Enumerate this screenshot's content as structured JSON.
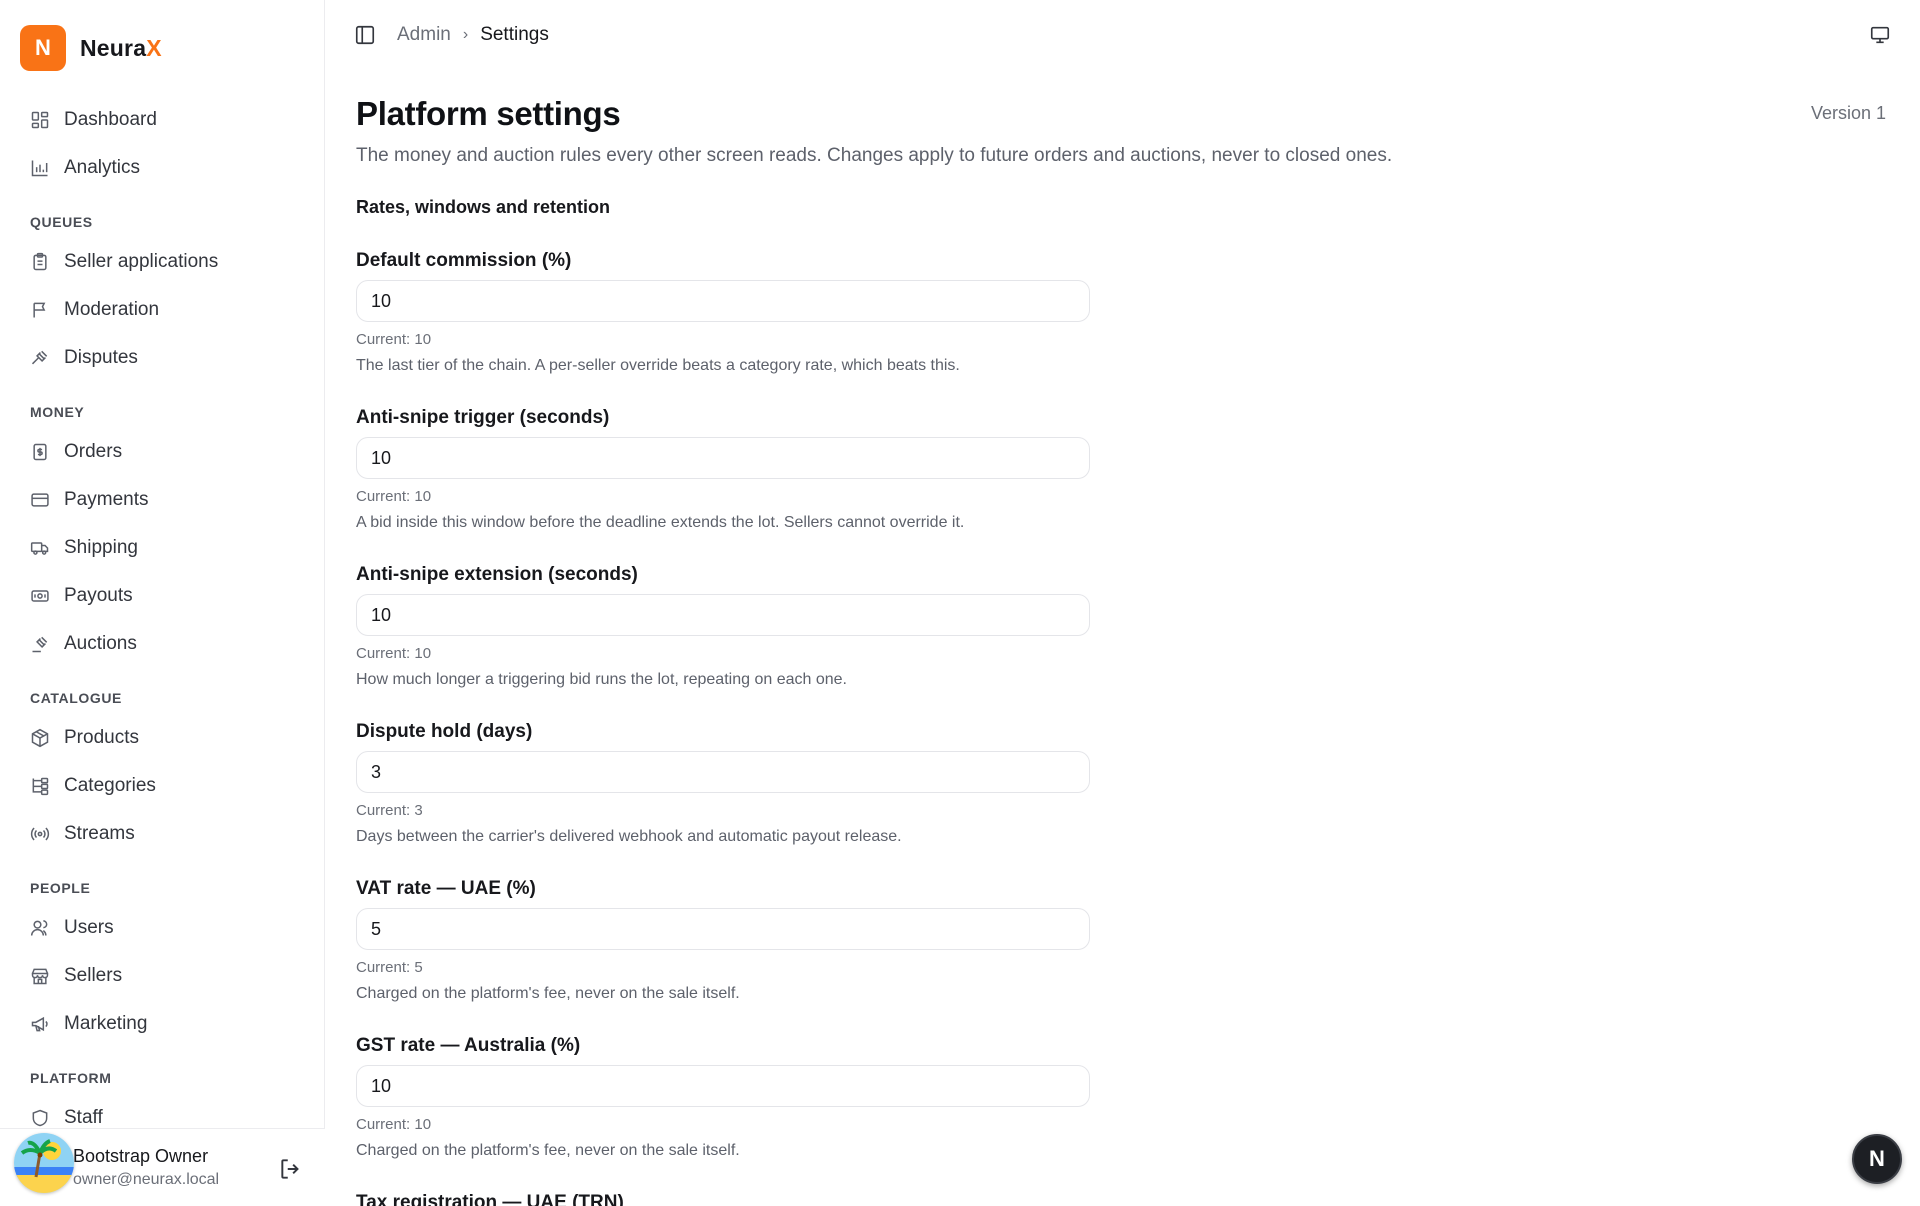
{
  "brand": {
    "logo_letter": "N",
    "name_main": "Neura",
    "name_accent": "X",
    "accent_color": "#f97316"
  },
  "nav": {
    "top": [
      {
        "label": "Dashboard",
        "icon": "dashboard-icon"
      },
      {
        "label": "Analytics",
        "icon": "bar-chart-icon"
      }
    ],
    "queues": {
      "title": "QUEUES",
      "items": [
        {
          "label": "Seller applications",
          "icon": "clipboard-icon"
        },
        {
          "label": "Moderation",
          "icon": "flag-icon"
        },
        {
          "label": "Disputes",
          "icon": "gavel-icon"
        }
      ]
    },
    "money": {
      "title": "MONEY",
      "items": [
        {
          "label": "Orders",
          "icon": "receipt-icon"
        },
        {
          "label": "Payments",
          "icon": "credit-card-icon"
        },
        {
          "label": "Shipping",
          "icon": "truck-icon"
        },
        {
          "label": "Payouts",
          "icon": "banknote-icon"
        },
        {
          "label": "Auctions",
          "icon": "gavel-icon"
        }
      ]
    },
    "catalogue": {
      "title": "CATALOGUE",
      "items": [
        {
          "label": "Products",
          "icon": "package-icon"
        },
        {
          "label": "Categories",
          "icon": "tree-icon"
        },
        {
          "label": "Streams",
          "icon": "broadcast-icon"
        }
      ]
    },
    "people": {
      "title": "PEOPLE",
      "items": [
        {
          "label": "Users",
          "icon": "users-icon"
        },
        {
          "label": "Sellers",
          "icon": "store-icon"
        },
        {
          "label": "Marketing",
          "icon": "megaphone-icon"
        }
      ]
    },
    "platform": {
      "title": "PLATFORM",
      "items": [
        {
          "label": "Staff",
          "icon": "shield-icon"
        }
      ]
    }
  },
  "user": {
    "name": "Bootstrap Owner",
    "email": "owner@neurax.local"
  },
  "breadcrumb": {
    "parent": "Admin",
    "current": "Settings"
  },
  "page": {
    "title": "Platform settings",
    "version": "Version 1",
    "subtitle": "The money and auction rules every other screen reads. Changes apply to future orders and auctions, never to closed ones.",
    "section": "Rates, windows and retention"
  },
  "fields": [
    {
      "label": "Default commission (%)",
      "value": "10",
      "current": "Current: 10",
      "help": "The last tier of the chain. A per-seller override beats a category rate, which beats this."
    },
    {
      "label": "Anti-snipe trigger (seconds)",
      "value": "10",
      "current": "Current: 10",
      "help": "A bid inside this window before the deadline extends the lot. Sellers cannot override it."
    },
    {
      "label": "Anti-snipe extension (seconds)",
      "value": "10",
      "current": "Current: 10",
      "help": "How much longer a triggering bid runs the lot, repeating on each one."
    },
    {
      "label": "Dispute hold (days)",
      "value": "3",
      "current": "Current: 3",
      "help": "Days between the carrier's delivered webhook and automatic payout release."
    },
    {
      "label": "VAT rate — UAE (%)",
      "value": "5",
      "current": "Current: 5",
      "help": "Charged on the platform's fee, never on the sale itself."
    },
    {
      "label": "GST rate — Australia (%)",
      "value": "10",
      "current": "Current: 10",
      "help": "Charged on the platform's fee, never on the sale itself."
    },
    {
      "label": "Tax registration — UAE (TRN)",
      "value": ""
    }
  ],
  "fab": {
    "letter": "N"
  }
}
